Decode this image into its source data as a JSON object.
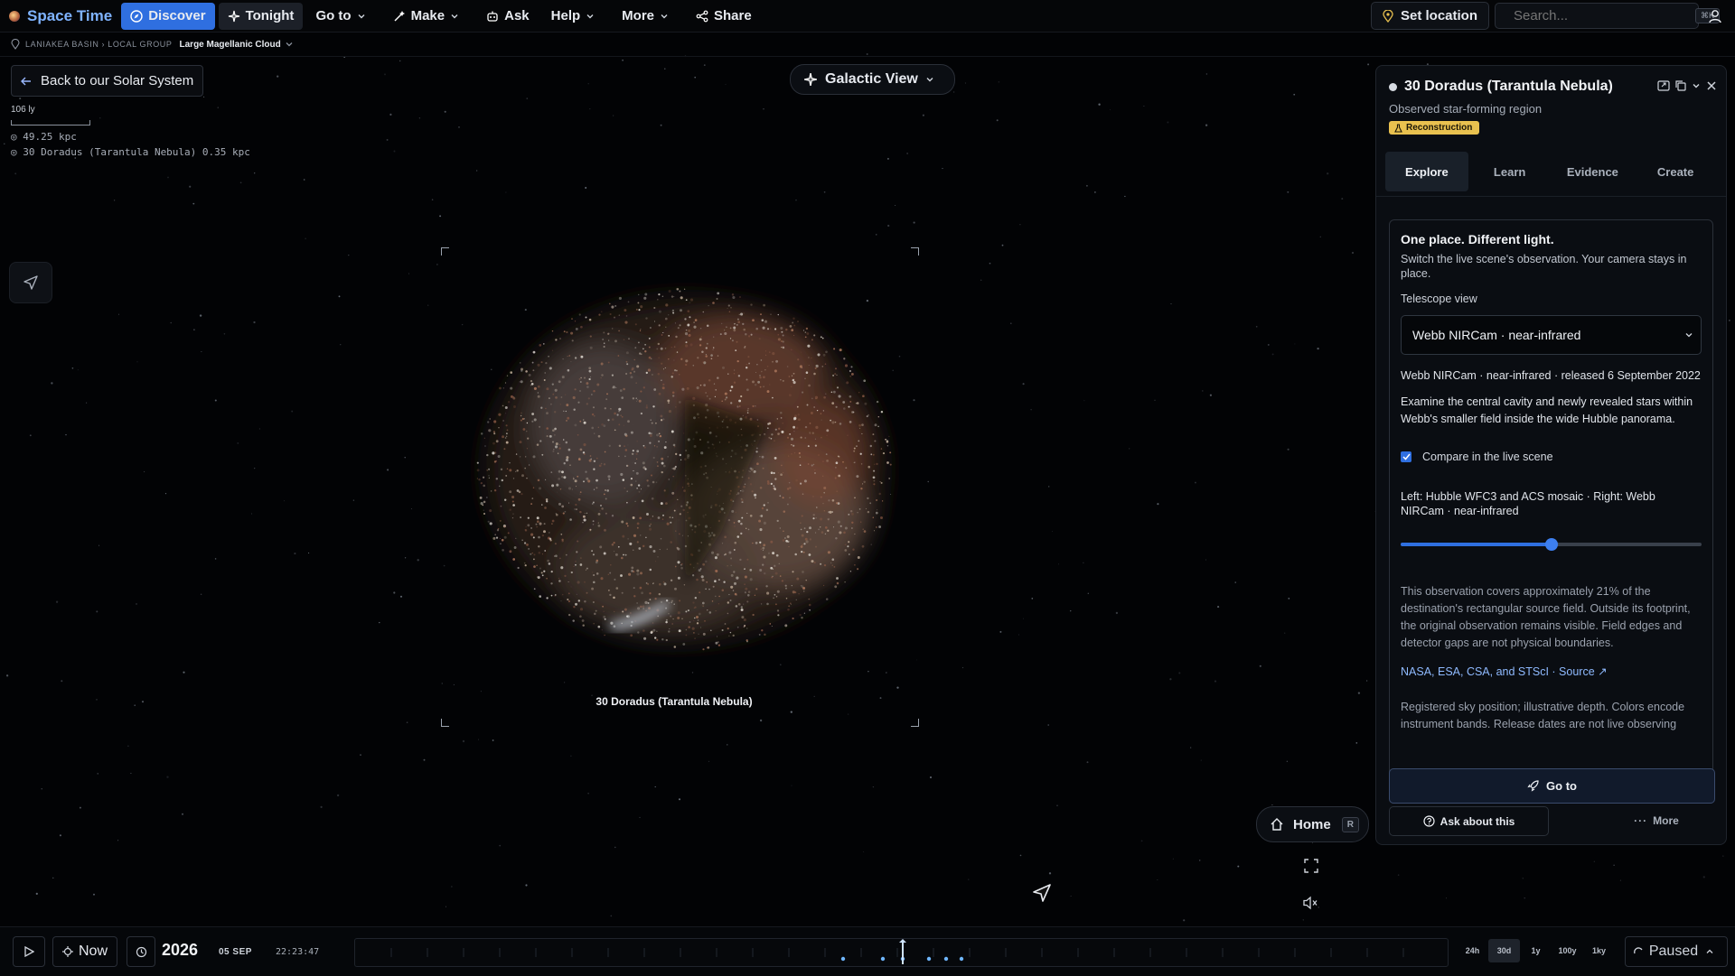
{
  "app": {
    "name": "Space Time"
  },
  "nav": {
    "discover": "Discover",
    "tonight": "Tonight",
    "goto": "Go to",
    "make": "Make",
    "ask": "Ask",
    "help": "Help",
    "more": "More",
    "share": "Share"
  },
  "topright": {
    "set_location": "Set location",
    "search_placeholder": "Search...",
    "search_shortcut": "⌘K"
  },
  "breadcrumb": {
    "path": "LANIAKEA BASIN › LOCAL GROUP",
    "current": "Large Magellanic Cloud"
  },
  "viewport": {
    "back_label": "Back to our Solar System",
    "scale_label": "106 ly",
    "readout_distance": "◎ 49.25 kpc",
    "readout_target": "◎ 30 Doradus (Tarantula Nebula) 0.35 kpc",
    "view_mode": "Galactic View",
    "nebula_label": "30 Doradus (Tarantula Nebula)",
    "home_label": "Home",
    "home_key": "R"
  },
  "panel": {
    "title": "30 Doradus (Tarantula Nebula)",
    "subtitle": "Observed star-forming region",
    "badge": "Reconstruction",
    "tabs": [
      "Explore",
      "Learn",
      "Evidence",
      "Create"
    ],
    "card_heading": "One place. Different light.",
    "card_intro": "Switch the live scene's observation. Your camera stays in place.",
    "telescope_label": "Telescope view",
    "telescope_selected": "Webb NIRCam · near-infrared",
    "release_text": "Webb NIRCam · near-infrared · released 6 September 2022",
    "examine_text": "Examine the central cavity and newly revealed stars within Webb's smaller field inside the wide Hubble panorama.",
    "compare_label": "Compare in the live scene",
    "compare_checked": true,
    "compare_detail": "Left: Hubble WFC3 and ACS mosaic · Right: Webb NIRCam · near-infrared",
    "slider_value": 0.5,
    "coverage_text": "This observation covers approximately 21% of the destination's rectangular source field. Outside its footprint, the original observation remains visible. Field edges and detector gaps are not physical boundaries.",
    "credit_text": "NASA, ESA, CSA, and STScI · Source ↗",
    "registered_text": "Registered sky position; illustrative depth. Colors encode instrument bands. Release dates are not live observing",
    "goto_label": "Go to",
    "ask_label": "Ask about this",
    "more_label": "More"
  },
  "bottombar": {
    "now_label": "Now",
    "year": "2026",
    "date": "05 SEP",
    "time": "22:23:47",
    "ranges": [
      "24h",
      "30d",
      "1y",
      "100y",
      "1ky"
    ],
    "active_range": "30d",
    "status": "Paused"
  },
  "colors": {
    "accent": "#2f6fe0",
    "brand": "#7fb3ff",
    "badge": "#e9c14f"
  }
}
